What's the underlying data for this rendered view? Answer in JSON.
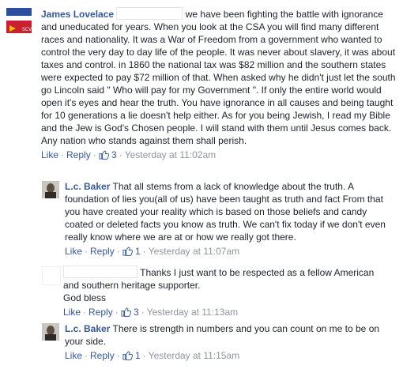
{
  "comments": [
    {
      "author": "James Lovelace",
      "text": "we have been fighting the battle with ignorance and uneducated for years. When you look at the CSA you will find many different races and nationality. It was a War of Freedom from a government who wanted to control the very day to day life of the people. It was never about slavery, it was about taxes and control. in 1860 the national tax was $82 million and the southern states were expected to pay $72 million of that. When asked why he didn't just let the south go Lincoln said \" Who will pay for my Government \". If only the entire world would open it's eyes and hear the truth. You have ignorance in all causes and being taught for 10 generations a lie doesn't help either. As for you being Jewish, I read my Bible and the Jew is God's Chosen people. I will stand with them until Jesus comes back. Any nation who stands against them shall perish.",
      "like": "Like",
      "reply": "Reply",
      "likes": "3",
      "time": "Yesterday at 11:02am"
    },
    {
      "author": "L.c. Baker",
      "text": "That all stems from a lack of knowledge about the truth. A foundation of lies you(all of us) have been taught as truth and fact From that you have created your reality which is based on those beliefs and candy coated or deleted facts you know as truth. We can't fix today if we don't even really know where we are at or how we really got there.",
      "like": "Like",
      "reply": "Reply",
      "likes": "1",
      "time": "Yesterday at 11:07am"
    },
    {
      "author": "",
      "text_line1": "Thanks I just want to be respected as a fellow American",
      "text_line2": "and southern heritage supporter.",
      "text_line3": "God bless",
      "like": "Like",
      "reply": "Reply",
      "likes": "3",
      "time": "Yesterday at 11:13am"
    },
    {
      "author": "L.c. Baker",
      "text": "There is strength in numbers and you can count on me to be on your side.",
      "like": "Like",
      "reply": "Reply",
      "likes": "1",
      "time": "Yesterday at 11:15am"
    }
  ],
  "colors": {
    "link": "#365899",
    "meta": "#90949c",
    "text": "#1d2129"
  }
}
